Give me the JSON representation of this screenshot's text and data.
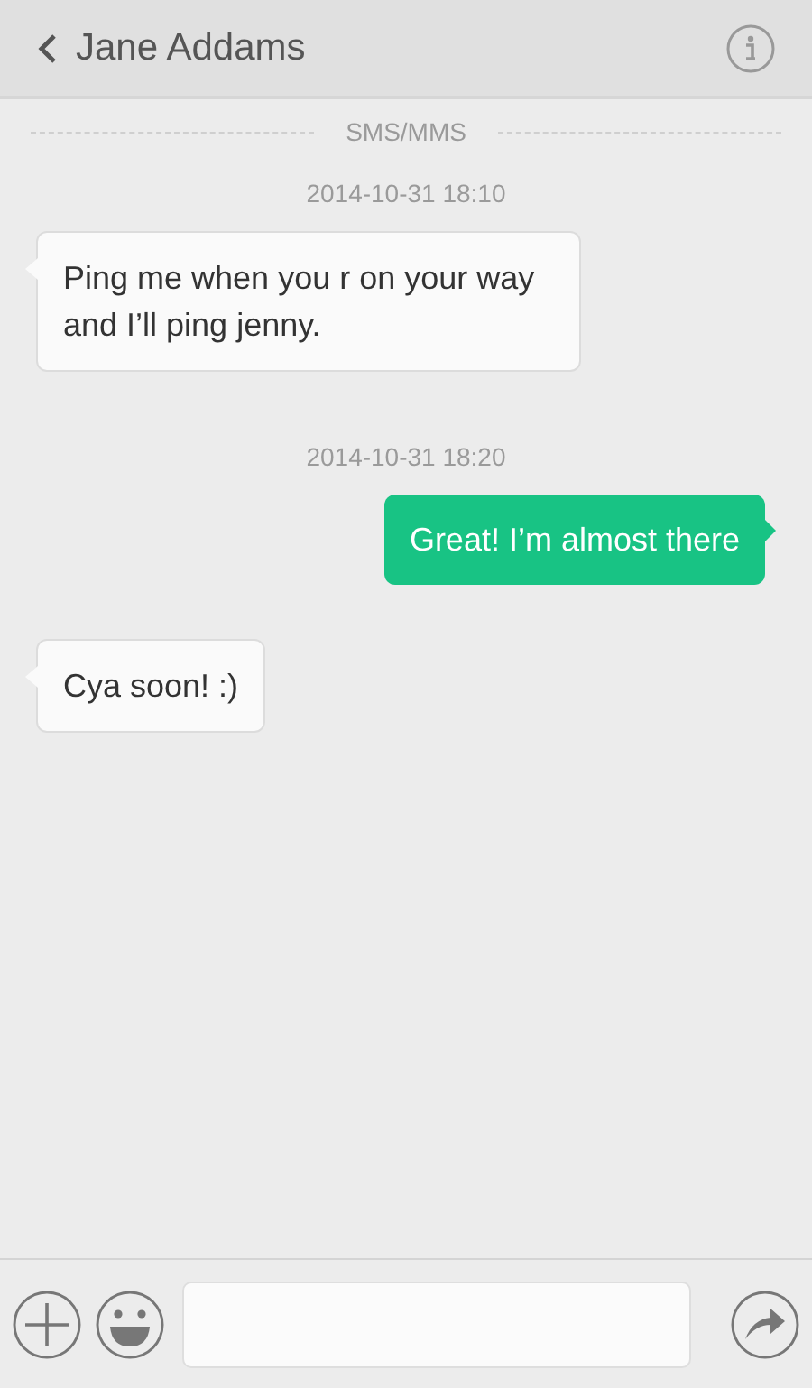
{
  "header": {
    "contact": "Jane Addams"
  },
  "channel_label": "SMS/MMS",
  "items": [
    {
      "kind": "timestamp",
      "text": "2014-10-31 18:10"
    },
    {
      "kind": "incoming",
      "text": "Ping me when you r on your way and I’ll ping jenny."
    },
    {
      "kind": "timestamp",
      "text": "2014-10-31 18:20"
    },
    {
      "kind": "outgoing",
      "text": "Great! I’m almost there"
    },
    {
      "kind": "incoming",
      "text": "Cya soon! :)"
    }
  ]
}
